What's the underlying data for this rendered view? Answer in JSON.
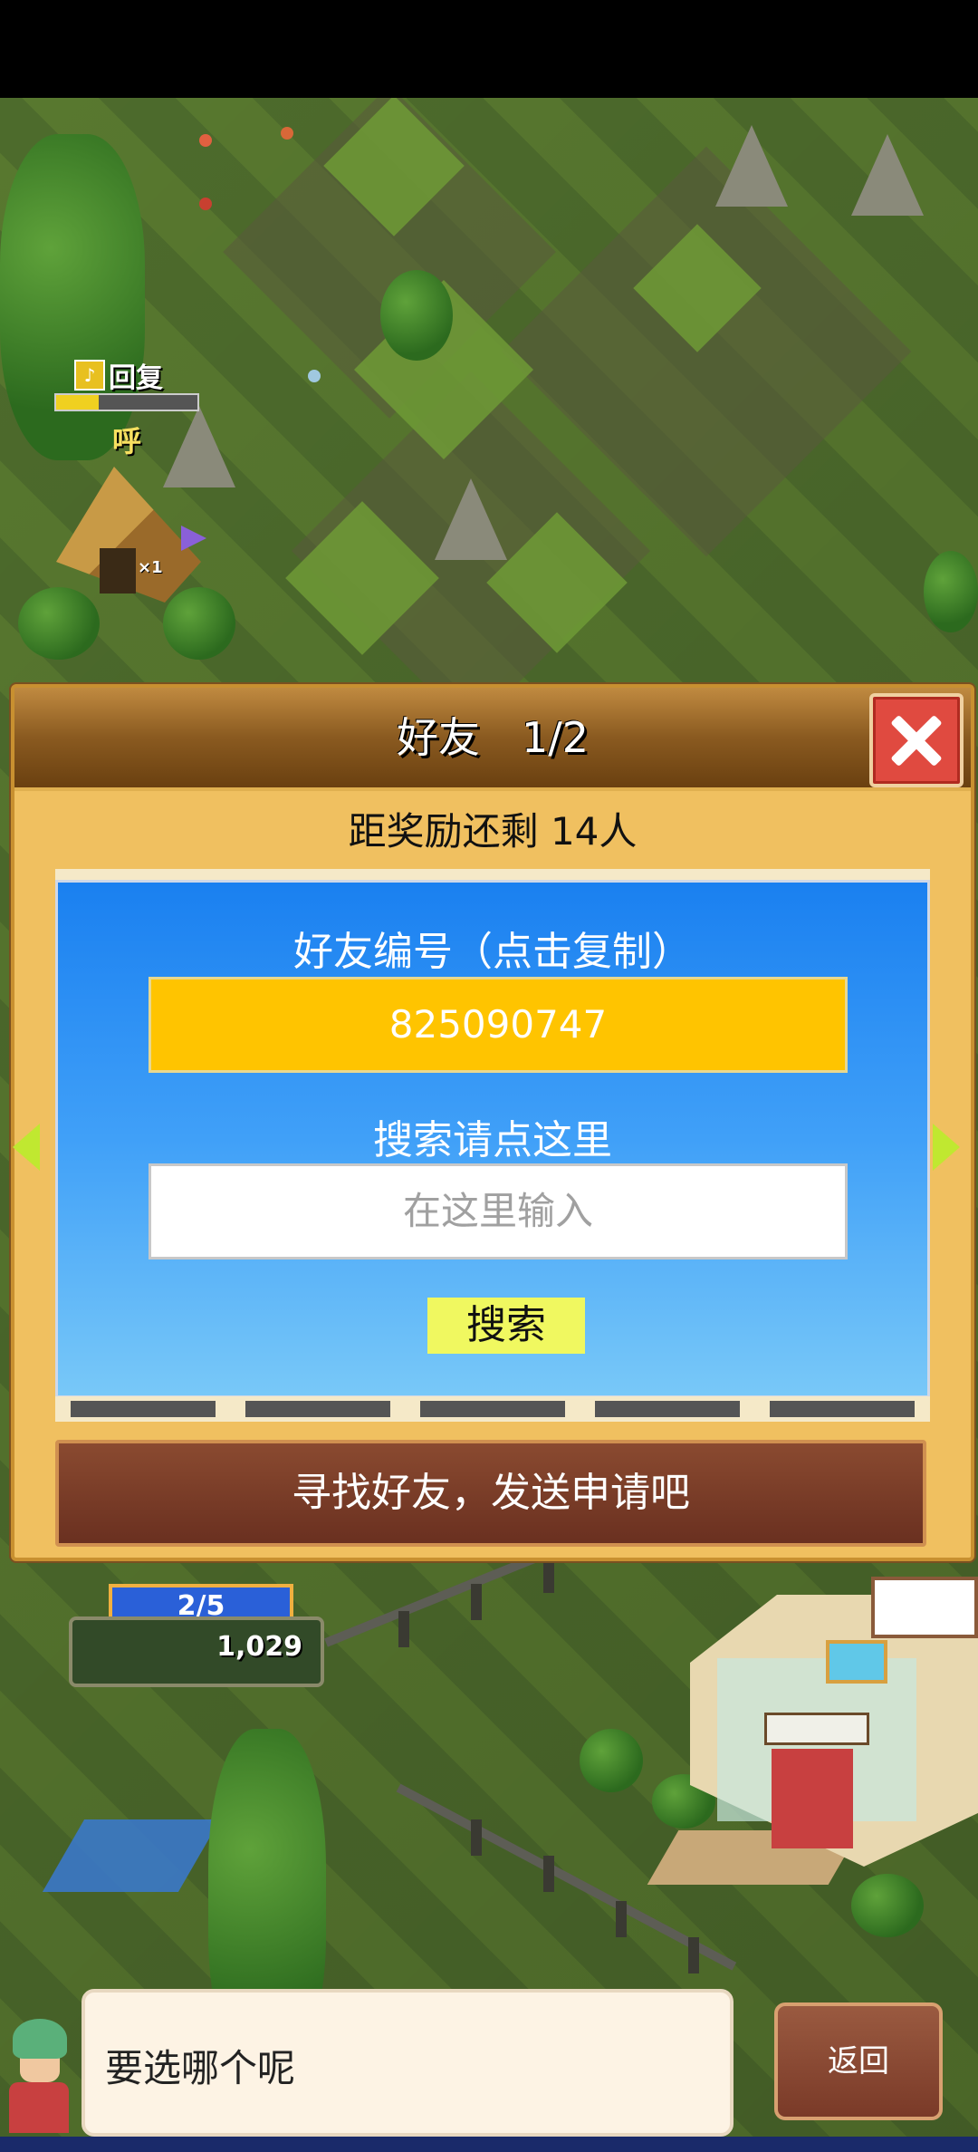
{
  "hud": {
    "recover_label": "回复",
    "recover_progress": 0.3,
    "sound_effect": "呼",
    "tent_multiplier": "×1",
    "occupancy": "2/5",
    "money": "1,029"
  },
  "dialog": {
    "title": "好友　1/2",
    "reward_remaining": "距奖励还剩 14人",
    "friend_id_label": "好友编号（点击复制）",
    "friend_id_value": "825090747",
    "search_label": "搜索请点这里",
    "search_placeholder": "在这里输入",
    "search_value": "",
    "search_button": "搜索",
    "find_friends_button": "寻找好友，发送申请吧",
    "accent_colors": {
      "panel_blue": "#1a80f0",
      "id_box": "#ffc400",
      "search_button": "#f0f860",
      "close_button": "#e04a40"
    }
  },
  "footer": {
    "message": "要选哪个呢",
    "back_button": "返回"
  },
  "icons": {
    "close": "close-icon",
    "prev": "arrow-left-icon",
    "next": "arrow-right-icon",
    "recover": "recover-icon"
  }
}
